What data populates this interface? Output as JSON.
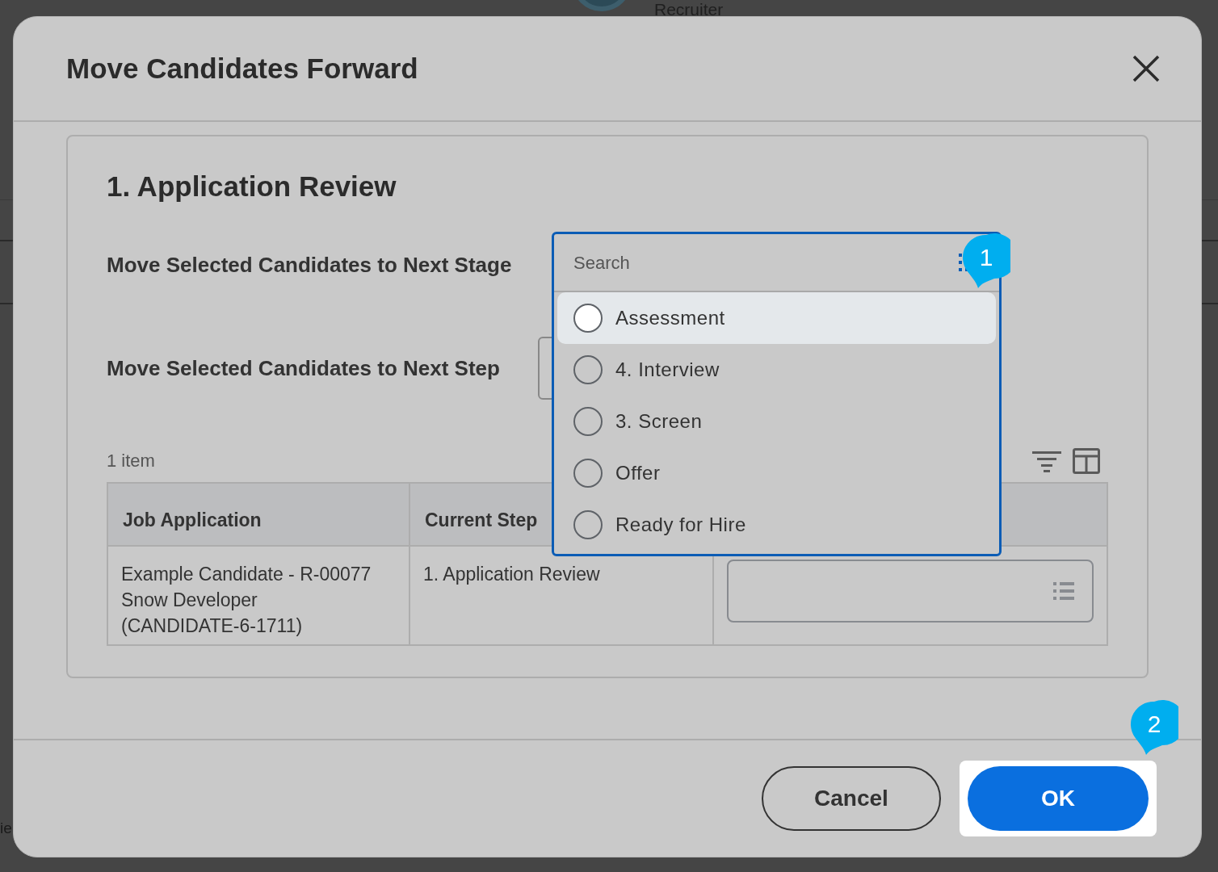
{
  "background": {
    "user_role": "Recruiter",
    "edge_fragment": "ie"
  },
  "dialog": {
    "title": "Move Candidates Forward",
    "section_title": "1. Application Review",
    "stage_label": "Move Selected Candidates to Next Stage",
    "step_label": "Move Selected Candidates to Next Step",
    "dropdown": {
      "placeholder": "Search",
      "options": [
        {
          "label": "Assessment",
          "selected": false,
          "focused": true
        },
        {
          "label": "4. Interview",
          "selected": false,
          "focused": false
        },
        {
          "label": "3. Screen",
          "selected": false,
          "focused": false
        },
        {
          "label": "Offer",
          "selected": false,
          "focused": false
        },
        {
          "label": "Ready for Hire",
          "selected": false,
          "focused": false
        }
      ]
    },
    "item_count": "1 item",
    "table": {
      "columns": [
        "Job Application",
        "Current Step"
      ],
      "rows": [
        {
          "job_application": [
            "Example Candidate - R-00077",
            "Snow Developer",
            "(CANDIDATE-6-1711)"
          ],
          "current_step": "1. Application Review"
        }
      ]
    },
    "buttons": [
      {
        "label": "Cancel",
        "kind": "secondary"
      },
      {
        "label": "OK",
        "kind": "primary"
      }
    ]
  },
  "annotations": [
    "1",
    "2"
  ]
}
